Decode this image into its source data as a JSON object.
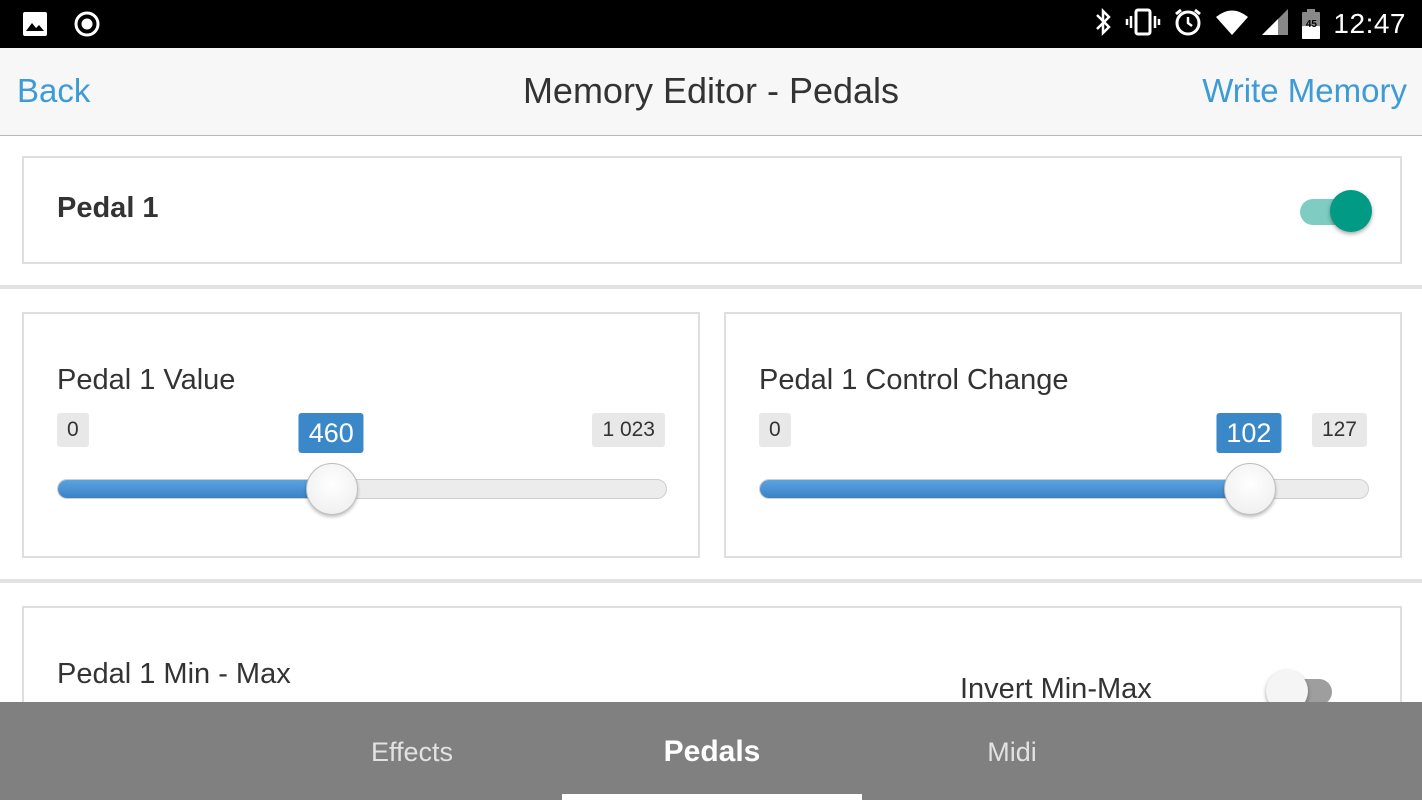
{
  "status_bar": {
    "left_icons": [
      "image-icon",
      "record-icon"
    ],
    "right_icons": [
      "bluetooth-icon",
      "vibrate-icon",
      "alarm-icon",
      "wifi-icon",
      "cell-signal-icon",
      "battery-icon"
    ],
    "battery_level": "45",
    "time": "12:47"
  },
  "header": {
    "back_label": "Back",
    "title": "Memory Editor - Pedals",
    "write_label": "Write Memory",
    "link_color": "#3d9bd6"
  },
  "pedal_card": {
    "title": "Pedal 1",
    "enabled": true,
    "toggle_on_color": "#009a85"
  },
  "sliders": [
    {
      "label": "Pedal 1 Value",
      "min": "0",
      "max": "1 023",
      "value": "460",
      "min_num": 0,
      "max_num": 1023,
      "value_num": 460
    },
    {
      "label": "Pedal 1 Control Change",
      "min": "0",
      "max": "127",
      "value": "102",
      "min_num": 0,
      "max_num": 127,
      "value_num": 102
    }
  ],
  "minmax_card": {
    "label": "Pedal 1 Min - Max",
    "invert_label": "Invert Min-Max",
    "invert_enabled": false
  },
  "bottom_nav": {
    "tabs": [
      {
        "label": "Effects",
        "active": false
      },
      {
        "label": "Pedals",
        "active": true
      },
      {
        "label": "Midi",
        "active": false
      }
    ]
  },
  "colors": {
    "accent": "#3b88c9",
    "nav_bg": "#808080"
  }
}
